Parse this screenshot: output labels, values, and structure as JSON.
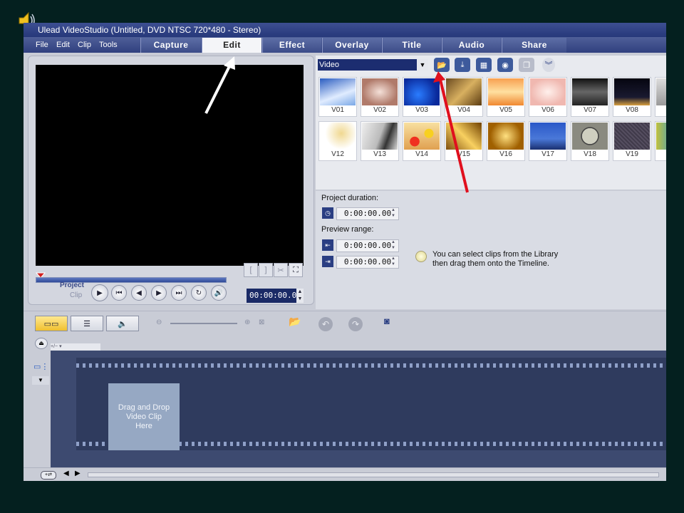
{
  "window": {
    "title": "Ulead VideoStudio (Untitled, DVD NTSC 720*480 - Stereo)"
  },
  "menu": [
    "File",
    "Edit",
    "Clip",
    "Tools"
  ],
  "tabs": [
    {
      "label": "Capture",
      "active": false
    },
    {
      "label": "Edit",
      "active": true
    },
    {
      "label": "Effect",
      "active": false
    },
    {
      "label": "Overlay",
      "active": false
    },
    {
      "label": "Title",
      "active": false
    },
    {
      "label": "Audio",
      "active": false
    },
    {
      "label": "Share",
      "active": false
    }
  ],
  "preview": {
    "mode_project": "Project",
    "mode_clip": "Clip",
    "timecode": "00:00:00.00"
  },
  "library": {
    "category": "Video",
    "thumbnails": [
      "V01",
      "V02",
      "V03",
      "V04",
      "V05",
      "V06",
      "V07",
      "V08",
      "V12",
      "V13",
      "V14",
      "V15",
      "V16",
      "V17",
      "V18",
      "V19"
    ]
  },
  "options": {
    "project_duration_label": "Project duration:",
    "project_duration_value": "0:00:00.00",
    "preview_range_label": "Preview range:",
    "range_start": "0:00:00.00",
    "range_end": "0:00:00.00",
    "tip_line1": "You can select clips from the Library",
    "tip_line2": "then drag them onto the Timeline."
  },
  "timeline": {
    "drop_line1": "Drag and Drop",
    "drop_line2": "Video Clip",
    "drop_line3": "Here"
  },
  "annotations": {
    "white_arrow_color": "#ffffff",
    "red_arrow_color": "#e0101e"
  },
  "colors": {
    "accent": "#1c2d70",
    "tab_bar": "#3c4c88"
  }
}
